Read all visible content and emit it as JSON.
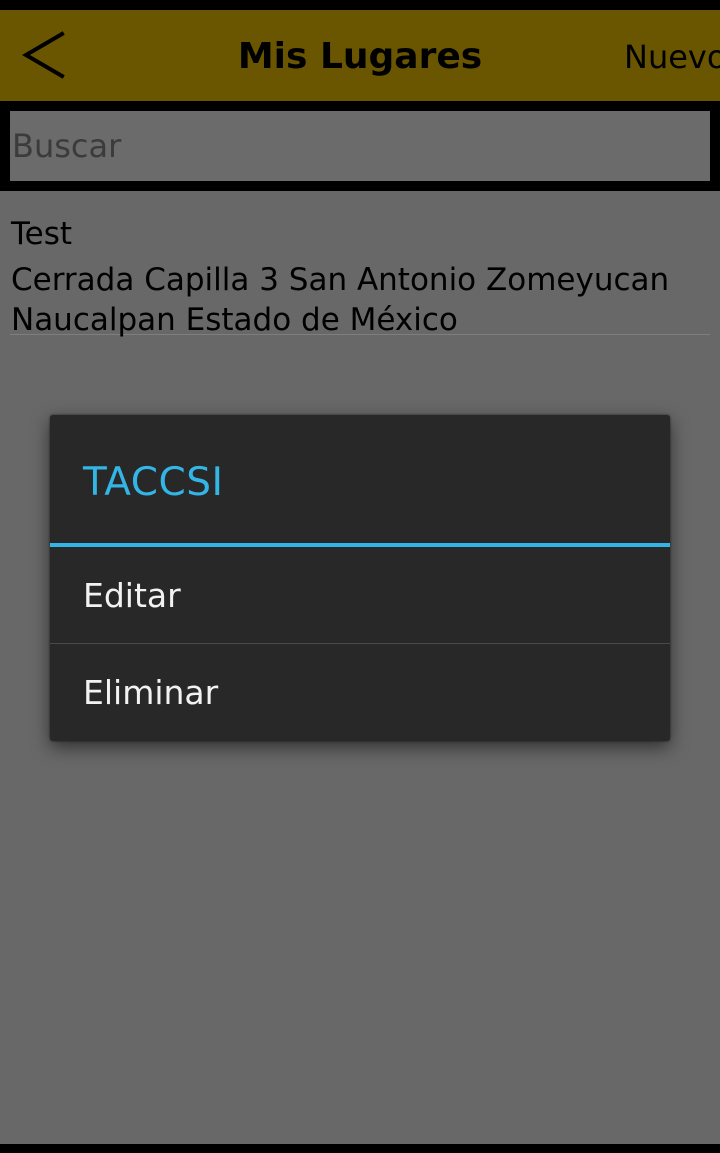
{
  "header": {
    "title": "Mis Lugares",
    "new_label": "Nuevo",
    "back_icon": "chevron-left-icon",
    "background_color": "#6a5600"
  },
  "search": {
    "placeholder": "Buscar",
    "value": ""
  },
  "places": [
    {
      "name": "Test",
      "address": "Cerrada Capilla 3 San Antonio Zomeyucan Naucalpan Estado de México"
    }
  ],
  "dialog": {
    "title": "TACCSI",
    "accent_color": "#33b5e5",
    "items": [
      {
        "label": "Editar"
      },
      {
        "label": "Eliminar"
      }
    ]
  }
}
